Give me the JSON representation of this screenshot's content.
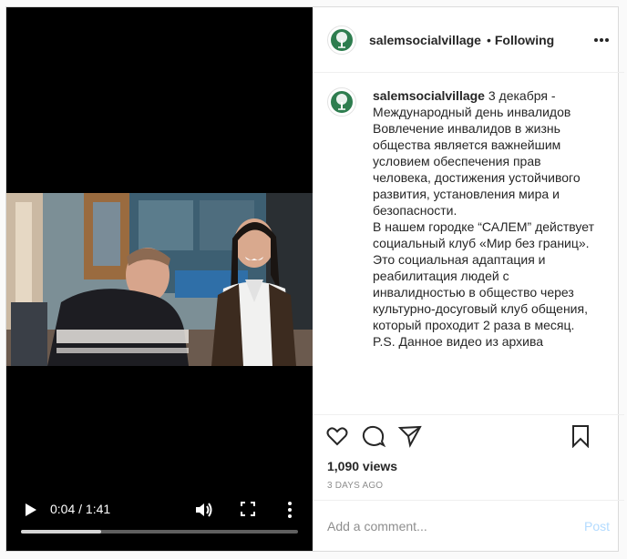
{
  "header": {
    "username": "salemsocialvillage",
    "separator": "•",
    "follow_status": "Following"
  },
  "video": {
    "time_display": "0:04 / 1:41",
    "progress_fraction": 0.29
  },
  "caption": {
    "username": "salemsocialvillage",
    "lines": [
      "3 декабря -",
      "Международный день инвалидов",
      "",
      "Вовлечение инвалидов в жизнь",
      "общества является важнейшим",
      "условием обеспечения прав",
      "человека, достижения устойчивого",
      "развития, установления мира и",
      "безопасности.",
      "",
      "В нашем городке “САЛЕМ” действует",
      "социальный клуб «Мир без границ».",
      "Это социальная адаптация и",
      "реабилитация людей с",
      "инвалидностью в общество через",
      "культурно-досуговый клуб общения,",
      "который проходит 2 раза в месяц.",
      "",
      "P.S. Данное видео из архива"
    ]
  },
  "stats": {
    "views": "1,090 views",
    "posted_ago": "3 DAYS AGO"
  },
  "comment": {
    "placeholder": "Add a comment...",
    "post_label": "Post"
  },
  "icons": {
    "avatar": "tree-logo-icon",
    "options": "more-horizontal-icon",
    "like": "heart-icon",
    "comment": "comment-bubble-icon",
    "share": "paper-plane-icon",
    "save": "bookmark-icon",
    "play": "play-icon",
    "volume": "volume-icon",
    "fullscreen": "fullscreen-icon",
    "video_more": "more-vertical-icon"
  },
  "colors": {
    "brand_green": "#2e7d4f",
    "post_button": "#b3dbff",
    "muted_text": "#8e8e8e"
  }
}
